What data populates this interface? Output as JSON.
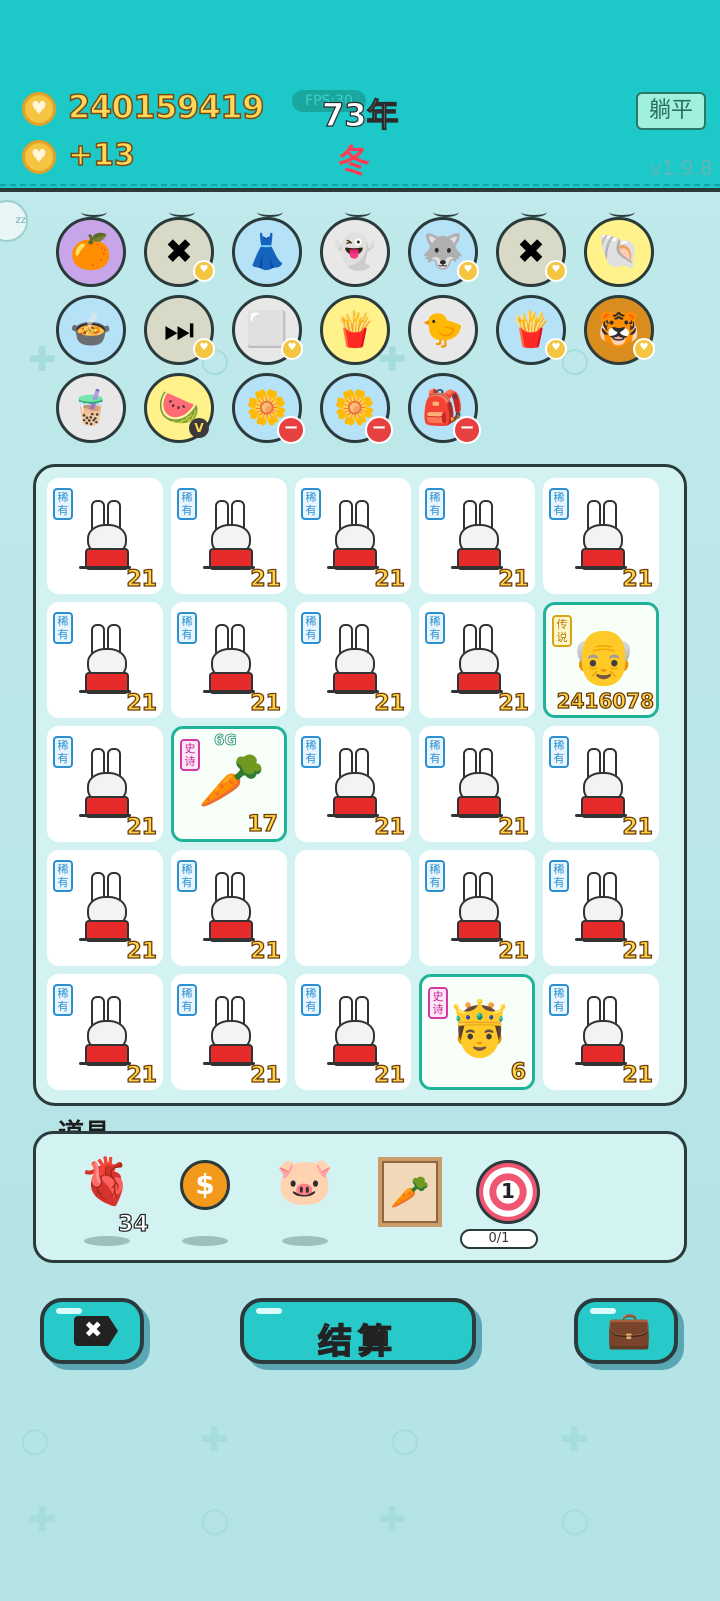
{
  "header": {
    "money": "240159419",
    "income": "+13",
    "fps": "FPS:30",
    "year": "73年",
    "season": "冬",
    "flat_button": "躺平",
    "version": "v1.9.8",
    "sleep_badge": "zz"
  },
  "inventory": {
    "items": [
      {
        "name": "pomelo-icon",
        "glyph": "🍊",
        "bg": "#c8a4e8",
        "badge": "none"
      },
      {
        "name": "cancel-tag-icon",
        "glyph": "✖",
        "bg": "#d9d9c7",
        "badge": "heart"
      },
      {
        "name": "skirt-icon",
        "glyph": "👗",
        "bg": "#b6e2f7",
        "badge": "none"
      },
      {
        "name": "ghost-icon",
        "glyph": "👻",
        "bg": "#e8e8e8",
        "badge": "none"
      },
      {
        "name": "husky-icon",
        "glyph": "🐺",
        "bg": "#b6e2f7",
        "badge": "heart"
      },
      {
        "name": "cancel-tag-icon",
        "glyph": "✖",
        "bg": "#d9d9c7",
        "badge": "heart"
      },
      {
        "name": "shell-icon",
        "glyph": "🐚",
        "bg": "#fff28a",
        "badge": "none"
      },
      {
        "name": "rice-cooker-icon",
        "glyph": "🍲",
        "bg": "#b6e2f7",
        "badge": "none"
      },
      {
        "name": "skip-icon",
        "glyph": "⏭",
        "bg": "#d9d9c7",
        "badge": "heart"
      },
      {
        "name": "tofu-icon",
        "glyph": "⬜",
        "bg": "#e8e8e8",
        "badge": "heart"
      },
      {
        "name": "fries-icon",
        "glyph": "🍟",
        "bg": "#fff28a",
        "badge": "none"
      },
      {
        "name": "chick-icon",
        "glyph": "🐤",
        "bg": "#e8e8e8",
        "badge": "none"
      },
      {
        "name": "fries-icon",
        "glyph": "🍟",
        "bg": "#b6e2f7",
        "badge": "heart"
      },
      {
        "name": "tiger-icon",
        "glyph": "🐯",
        "bg": "#d98d1f",
        "badge": "heart"
      },
      {
        "name": "milk-tea-icon",
        "glyph": "🧋",
        "bg": "#e8e8e8",
        "badge": "none"
      },
      {
        "name": "fruit-basket-icon",
        "glyph": "🍉",
        "bg": "#fff28a",
        "badge": "v"
      },
      {
        "name": "flower-pot-icon",
        "glyph": "🌼",
        "bg": "#b6e2f7",
        "badge": "minus"
      },
      {
        "name": "flower-pot-icon",
        "glyph": "🌼",
        "bg": "#b6e2f7",
        "badge": "minus"
      },
      {
        "name": "seed-bag-icon",
        "glyph": "🎒",
        "bg": "#b6e2f7",
        "badge": "minus"
      }
    ]
  },
  "board": {
    "cells": [
      {
        "kind": "bunny",
        "tag": "稀有",
        "tier": "rare",
        "value": "21"
      },
      {
        "kind": "bunny",
        "tag": "稀有",
        "tier": "rare",
        "value": "21"
      },
      {
        "kind": "bunny",
        "tag": "稀有",
        "tier": "rare",
        "value": "21"
      },
      {
        "kind": "bunny",
        "tag": "稀有",
        "tier": "rare",
        "value": "21"
      },
      {
        "kind": "bunny",
        "tag": "稀有",
        "tier": "rare",
        "value": "21"
      },
      {
        "kind": "bunny",
        "tag": "稀有",
        "tier": "rare",
        "value": "21"
      },
      {
        "kind": "bunny",
        "tag": "稀有",
        "tier": "rare",
        "value": "21"
      },
      {
        "kind": "bunny",
        "tag": "稀有",
        "tier": "rare",
        "value": "21"
      },
      {
        "kind": "bunny",
        "tag": "稀有",
        "tier": "rare",
        "value": "21"
      },
      {
        "kind": "oldman",
        "tag": "传说",
        "tier": "legend",
        "value": "2416078",
        "glyph": "👴"
      },
      {
        "kind": "bunny",
        "tag": "稀有",
        "tier": "rare",
        "value": "21"
      },
      {
        "kind": "carrot",
        "tag": "史诗",
        "tier": "epic",
        "value": "17",
        "glyph": "🥕",
        "rank": "6G"
      },
      {
        "kind": "bunny",
        "tag": "稀有",
        "tier": "rare",
        "value": "21"
      },
      {
        "kind": "bunny",
        "tag": "稀有",
        "tier": "rare",
        "value": "21"
      },
      {
        "kind": "bunny",
        "tag": "稀有",
        "tier": "rare",
        "value": "21"
      },
      {
        "kind": "bunny",
        "tag": "稀有",
        "tier": "rare",
        "value": "21"
      },
      {
        "kind": "bunny",
        "tag": "稀有",
        "tier": "rare",
        "value": "21"
      },
      {
        "kind": "empty",
        "tag": "",
        "tier": "",
        "value": ""
      },
      {
        "kind": "bunny",
        "tag": "稀有",
        "tier": "rare",
        "value": "21"
      },
      {
        "kind": "bunny",
        "tag": "稀有",
        "tier": "rare",
        "value": "21"
      },
      {
        "kind": "bunny",
        "tag": "稀有",
        "tier": "rare",
        "value": "21"
      },
      {
        "kind": "bunny",
        "tag": "稀有",
        "tier": "rare",
        "value": "21"
      },
      {
        "kind": "bunny",
        "tag": "稀有",
        "tier": "rare",
        "value": "21"
      },
      {
        "kind": "king",
        "tag": "史诗",
        "tier": "epic",
        "value": "6",
        "glyph": "🤴"
      },
      {
        "kind": "bunny",
        "tag": "稀有",
        "tier": "rare",
        "value": "21"
      }
    ]
  },
  "tools": {
    "label": "道具",
    "liver_count": "34",
    "target_number": "1",
    "target_progress": "0/1",
    "coin_symbol": "$"
  },
  "buttons": {
    "remove_glyph": "✖",
    "settle": "结算"
  },
  "colors": {
    "header": "#1cc8c8",
    "background": "#b5e4e6",
    "coin_text": "#ffd85a",
    "season": "#ff3c55"
  }
}
